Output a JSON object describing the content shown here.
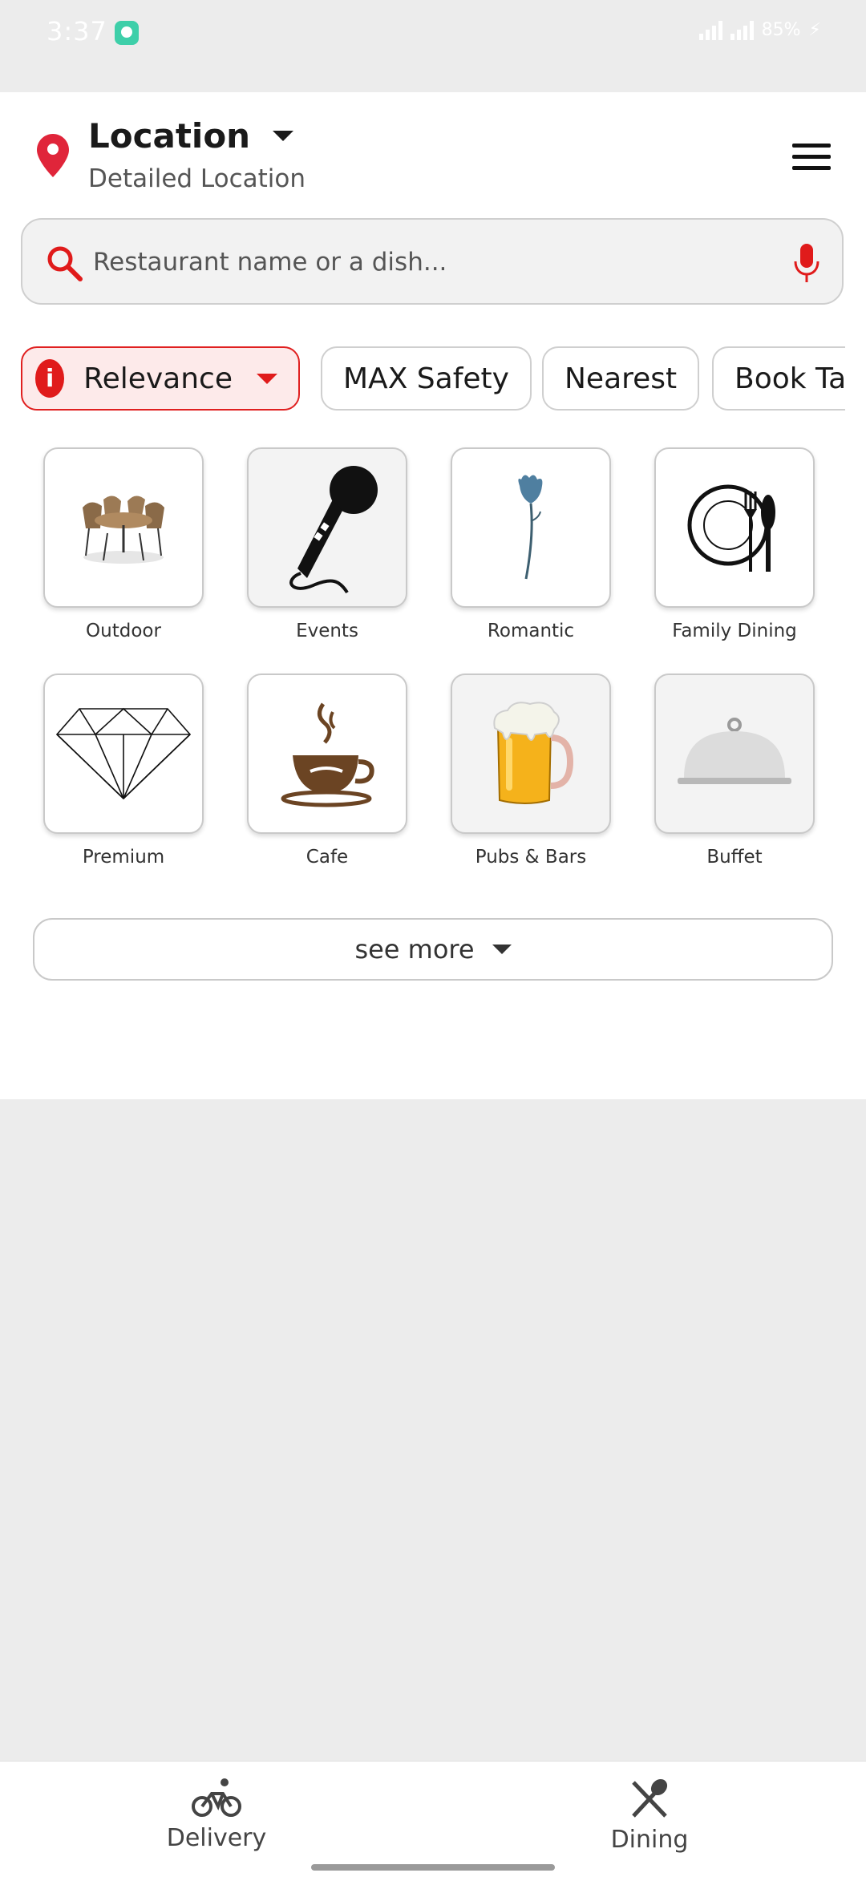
{
  "status_bar": {
    "time": "3:37",
    "battery": "85%"
  },
  "header": {
    "location_title": "Location",
    "location_subtitle": "Detailed Location"
  },
  "search": {
    "placeholder": "Restaurant name or a dish..."
  },
  "filters": [
    {
      "label": "Relevance",
      "active": true
    },
    {
      "label": "MAX Safety"
    },
    {
      "label": "Nearest"
    },
    {
      "label": "Book Table"
    }
  ],
  "categories": [
    {
      "label": "Outdoor",
      "icon": "outdoor-table-icon"
    },
    {
      "label": "Events",
      "icon": "microphone-icon"
    },
    {
      "label": "Romantic",
      "icon": "flower-icon"
    },
    {
      "label": "Family Dining",
      "icon": "plate-cutlery-icon"
    },
    {
      "label": "Premium",
      "icon": "diamond-icon"
    },
    {
      "label": "Cafe",
      "icon": "coffee-cup-icon"
    },
    {
      "label": "Pubs & Bars",
      "icon": "beer-mug-icon"
    },
    {
      "label": "Buffet",
      "icon": "cloche-icon"
    }
  ],
  "see_more_label": "see more",
  "bottom_nav": [
    {
      "label": "Delivery",
      "icon": "bicycle-icon"
    },
    {
      "label": "Dining",
      "icon": "cutlery-cross-icon"
    }
  ],
  "colors": {
    "accent": "#e01b1b",
    "page_bg": "#ececec"
  }
}
